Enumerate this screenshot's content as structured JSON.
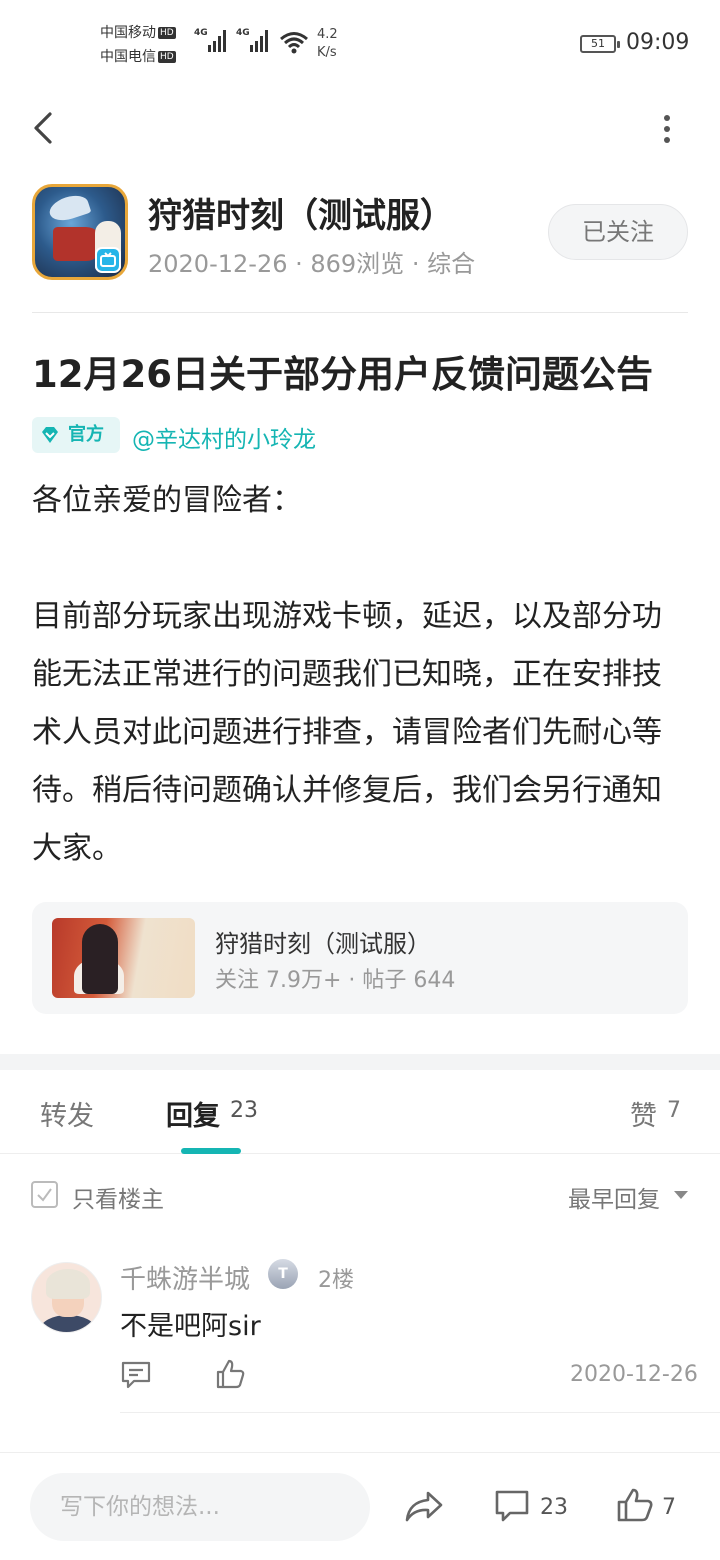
{
  "status_bar": {
    "carrier1": "中国移动",
    "carrier2": "中国电信",
    "hd": "HD",
    "net1": "4G",
    "net2": "4G",
    "speed_value": "4.2",
    "speed_unit": "K/s",
    "battery": "51",
    "time": "09:09"
  },
  "header": {
    "back_icon": "chevron-left-icon",
    "more_icon": "vertical-dots-icon"
  },
  "game": {
    "title": "狩猎时刻（测试服）",
    "date": "2020-12-26",
    "views": "869浏览",
    "category": "综合",
    "follow_label": "已关注"
  },
  "post": {
    "title": "12月26日关于部分用户反馈问题公告",
    "official_label": "官方",
    "mention": "@辛达村的小玲龙",
    "greeting": "各位亲爱的冒险者：",
    "paragraph": "目前部分玩家出现游戏卡顿，延迟，以及部分功能无法正常进行的问题我们已知晓，正在安排技术人员对此问题进行排查，请冒险者们先耐心等待。稍后待问题确认并修复后，我们会另行通知大家。"
  },
  "game_card": {
    "title": "狩猎时刻（测试服）",
    "followers": "关注 7.9万+",
    "posts": "帖子 644"
  },
  "tabs": {
    "repost": "转发",
    "reply": "回复",
    "reply_count": "23",
    "like": "赞",
    "like_count": "7"
  },
  "filter": {
    "only_op": "只看楼主",
    "sort": "最早回复"
  },
  "comments": [
    {
      "user": "千蛛游半城",
      "level_badge": "T",
      "floor": "2楼",
      "text": "不是吧阿sir",
      "date": "2020-12-26"
    }
  ],
  "bottom_bar": {
    "input_placeholder": "写下你的想法...",
    "comment_count": "23",
    "like_count": "7"
  },
  "colors": {
    "accent": "#15b5b3",
    "muted": "#999999"
  }
}
